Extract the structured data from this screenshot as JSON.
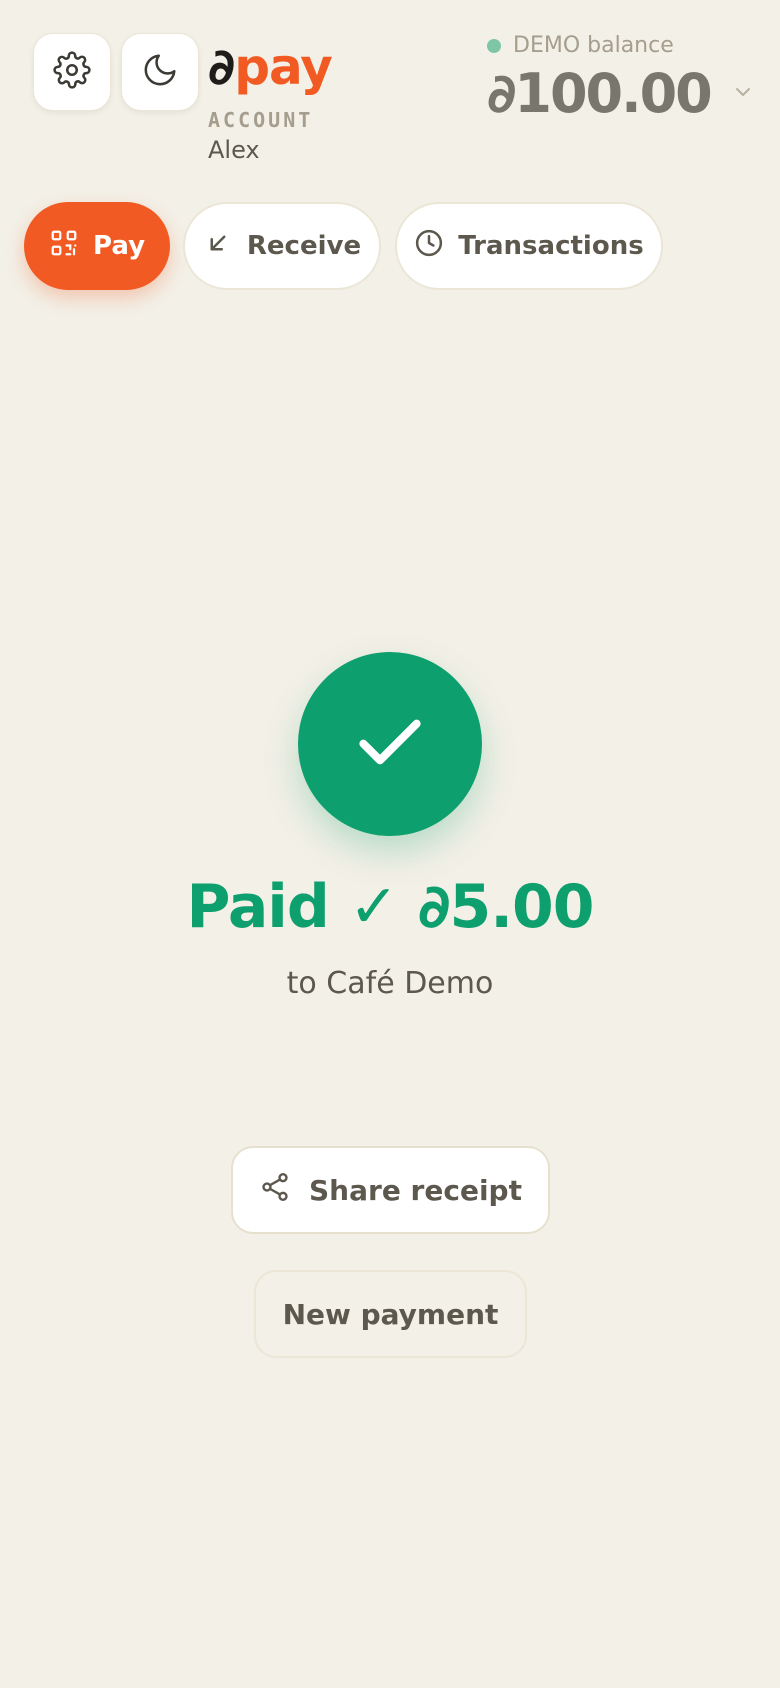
{
  "header": {
    "settings_icon": "gear-icon",
    "theme_icon": "moon-icon",
    "logo": {
      "mark": "∂",
      "text": "pay"
    },
    "account_label": "ACCOUNT",
    "account_name": "Alex"
  },
  "balance": {
    "label": "DEMO balance",
    "amount": "∂100.00",
    "status_color": "#7ec7a6"
  },
  "nav": {
    "pay": {
      "label": "Pay",
      "icon": "qr-code-icon",
      "active": true
    },
    "receive": {
      "label": "Receive",
      "icon": "arrow-down-left-icon"
    },
    "transactions": {
      "label": "Transactions",
      "icon": "clock-icon"
    }
  },
  "result": {
    "icon": "checkmark-icon",
    "title": "Paid ✓ ∂5.00",
    "recipient": "to Café Demo"
  },
  "actions": {
    "share_label": "Share receipt",
    "share_icon": "share-icon",
    "new_payment_label": "New payment"
  },
  "colors": {
    "accent": "#f25a23",
    "success": "#0e9f6e",
    "background": "#f3f0e7"
  }
}
